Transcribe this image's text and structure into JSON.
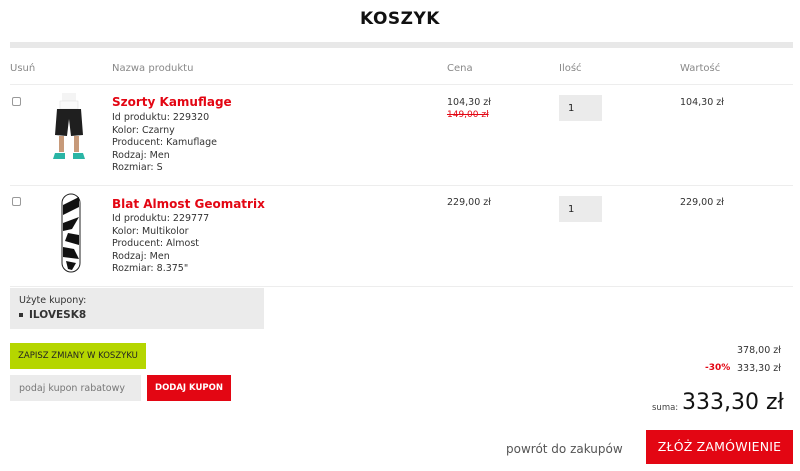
{
  "page": {
    "title": "KOSZYK"
  },
  "table": {
    "headers": {
      "remove": "Usuń",
      "name": "Nazwa produktu",
      "price": "Cena",
      "qty": "Ilość",
      "value": "Wartość"
    },
    "rows": [
      {
        "name": "Szorty Kamuflage",
        "details": [
          "Id produktu: 229320",
          "Kolor: Czarny",
          "Producent: Kamuflage",
          "Rodzaj: Men",
          "Rozmiar: S"
        ],
        "price": "104,30 zł",
        "old_price": "149,00 zł",
        "qty": "1",
        "value": "104,30 zł"
      },
      {
        "name": "Blat Almost Geomatrix",
        "details": [
          "Id produktu: 229777",
          "Kolor: Multikolor",
          "Producent: Almost",
          "Rodzaj: Men",
          "Rozmiar: 8.375\""
        ],
        "price": "229,00 zł",
        "qty": "1",
        "value": "229,00 zł"
      }
    ]
  },
  "coupons": {
    "label": "Użyte kupony:",
    "codes": [
      "ILOVESK8"
    ]
  },
  "actions": {
    "save_label": "ZAPISZ ZMIANY W KOSZYKU",
    "coupon_placeholder": "podaj kupon rabatowy",
    "add_coupon_label": "DODAJ KUPON",
    "back_label": "powrót do zakupów",
    "order_label": "ZŁÓŻ ZAMÓWIENIE"
  },
  "summary": {
    "subtotal": "378,00 zł",
    "discount_pct": "-30%",
    "discounted": "333,30 zł",
    "total_label": "suma:",
    "total": "333,30 zł"
  },
  "colors": {
    "accent_red": "#e30613",
    "accent_green": "#b5d600",
    "panel_gray": "#ebebeb"
  }
}
